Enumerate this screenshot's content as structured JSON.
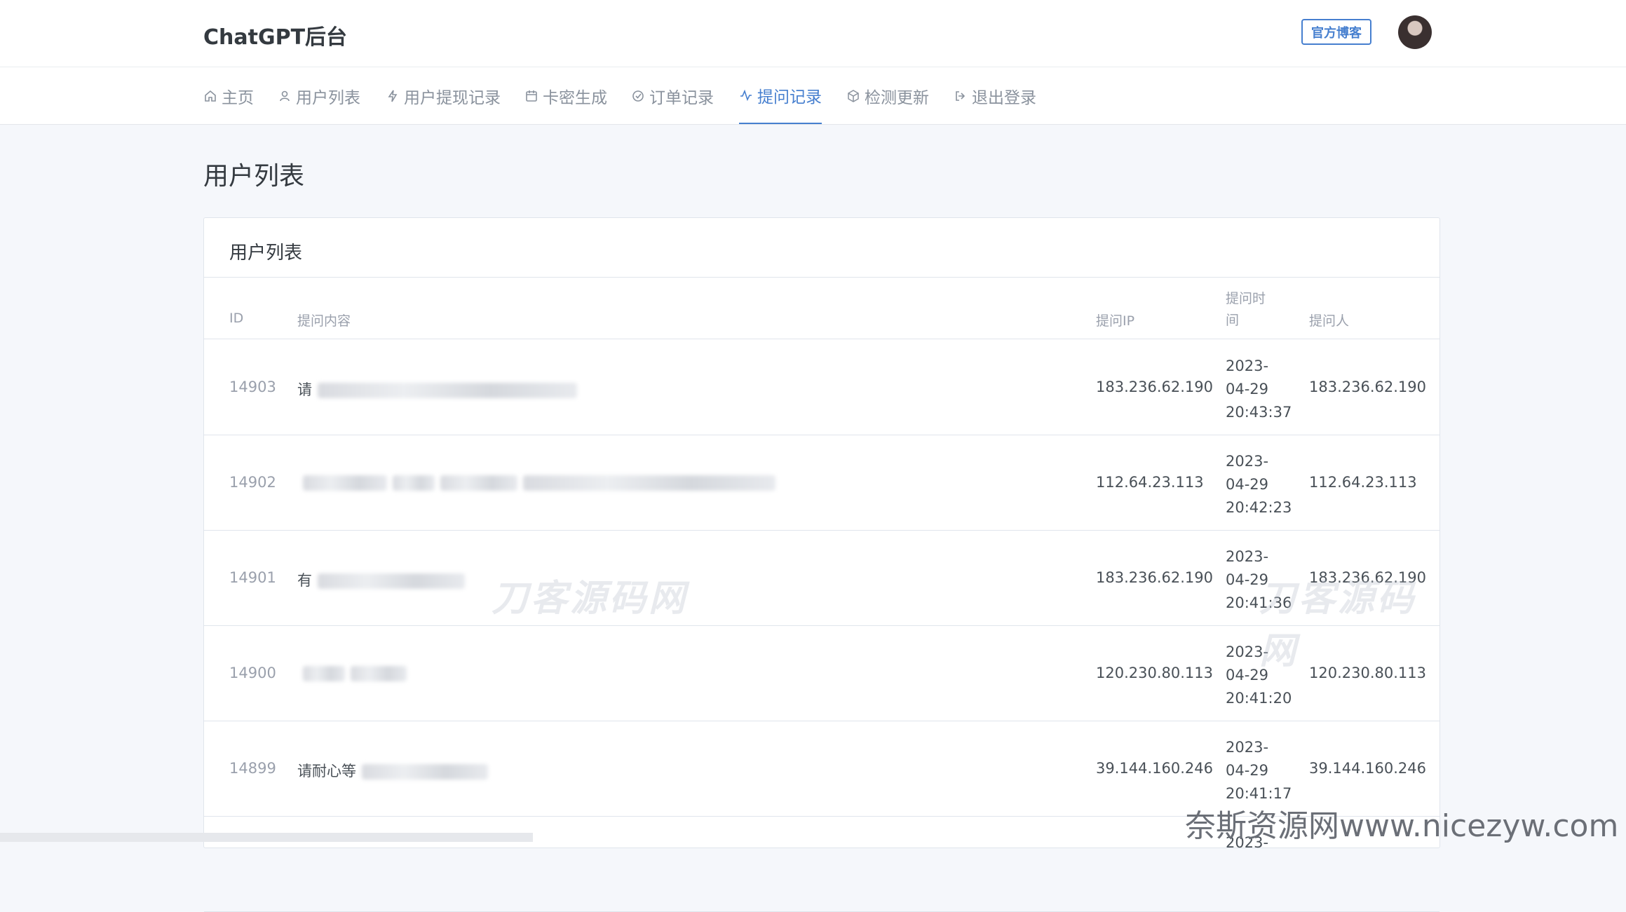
{
  "header": {
    "brand": "ChatGPT后台",
    "blog_button": "官方博客",
    "avatar_icon": "user-avatar"
  },
  "nav": {
    "items": [
      {
        "label": "主页",
        "icon": "home-icon"
      },
      {
        "label": "用户列表",
        "icon": "user-icon"
      },
      {
        "label": "用户提现记录",
        "icon": "bolt-icon"
      },
      {
        "label": "卡密生成",
        "icon": "calendar-icon"
      },
      {
        "label": "订单记录",
        "icon": "check-circle-icon"
      },
      {
        "label": "提问记录",
        "icon": "activity-icon"
      },
      {
        "label": "检测更新",
        "icon": "box-icon"
      },
      {
        "label": "退出登录",
        "icon": "logout-icon"
      }
    ],
    "active_index": 5
  },
  "page": {
    "title": "用户列表",
    "card_title": "用户列表"
  },
  "table": {
    "columns": [
      "ID",
      "提问内容",
      "提问IP",
      "提问时间",
      "提问人"
    ],
    "rows": [
      {
        "id": "14903",
        "content": "请",
        "ip": "183.236.62.190",
        "date": "2023-",
        "date2": "04-29",
        "time": "20:43:37",
        "asker": "183.236.62.190"
      },
      {
        "id": "14902",
        "content": "",
        "ip": "112.64.23.113",
        "date": "2023-",
        "date2": "04-29",
        "time": "20:42:23",
        "asker": "112.64.23.113"
      },
      {
        "id": "14901",
        "content": "有",
        "ip": "183.236.62.190",
        "date": "2023-",
        "date2": "04-29",
        "time": "20:41:36",
        "asker": "183.236.62.190"
      },
      {
        "id": "14900",
        "content": "",
        "ip": "120.230.80.113",
        "date": "2023-",
        "date2": "04-29",
        "time": "20:41:20",
        "asker": "120.230.80.113"
      },
      {
        "id": "14899",
        "content": "请耐心等",
        "ip": "39.144.160.246",
        "date": "2023-",
        "date2": "04-29",
        "time": "20:41:17",
        "asker": "39.144.160.246"
      },
      {
        "id": "",
        "content": "",
        "ip": "",
        "date": "2023-",
        "date2": "",
        "time": "",
        "asker": ""
      }
    ]
  },
  "watermarks": {
    "center": "刀客源码网",
    "right": "刀客源码网",
    "footer": "奈斯资源网www.nicezyw.com"
  },
  "colors": {
    "accent": "#467fcf",
    "background": "#f5f7fb"
  }
}
